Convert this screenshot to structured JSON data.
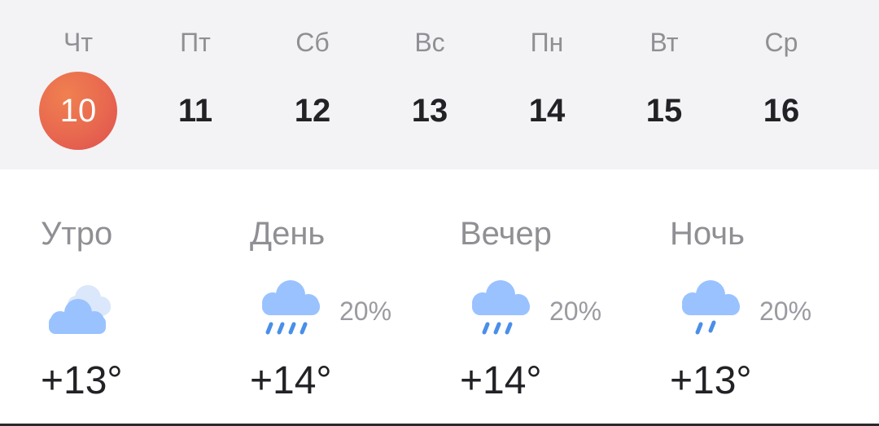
{
  "calendar": {
    "days": [
      {
        "dow": "Чт",
        "date": "10",
        "selected": true
      },
      {
        "dow": "Пт",
        "date": "11"
      },
      {
        "dow": "Сб",
        "date": "12"
      },
      {
        "dow": "Вс",
        "date": "13"
      },
      {
        "dow": "Пн",
        "date": "14"
      },
      {
        "dow": "Вт",
        "date": "15"
      },
      {
        "dow": "Ср",
        "date": "16"
      }
    ],
    "accent": "#e8684f"
  },
  "forecast": {
    "parts": [
      {
        "label": "Утро",
        "icon": "cloudy-icon",
        "precipitation": "",
        "temp": "+13°"
      },
      {
        "label": "День",
        "icon": "rain-icon",
        "precipitation": "20%",
        "temp": "+14°"
      },
      {
        "label": "Вечер",
        "icon": "light-rain-icon",
        "precipitation": "20%",
        "temp": "+14°"
      },
      {
        "label": "Ночь",
        "icon": "drizzle-icon",
        "precipitation": "20%",
        "temp": "+13°"
      }
    ],
    "cloud_color": "#99c2ff"
  }
}
